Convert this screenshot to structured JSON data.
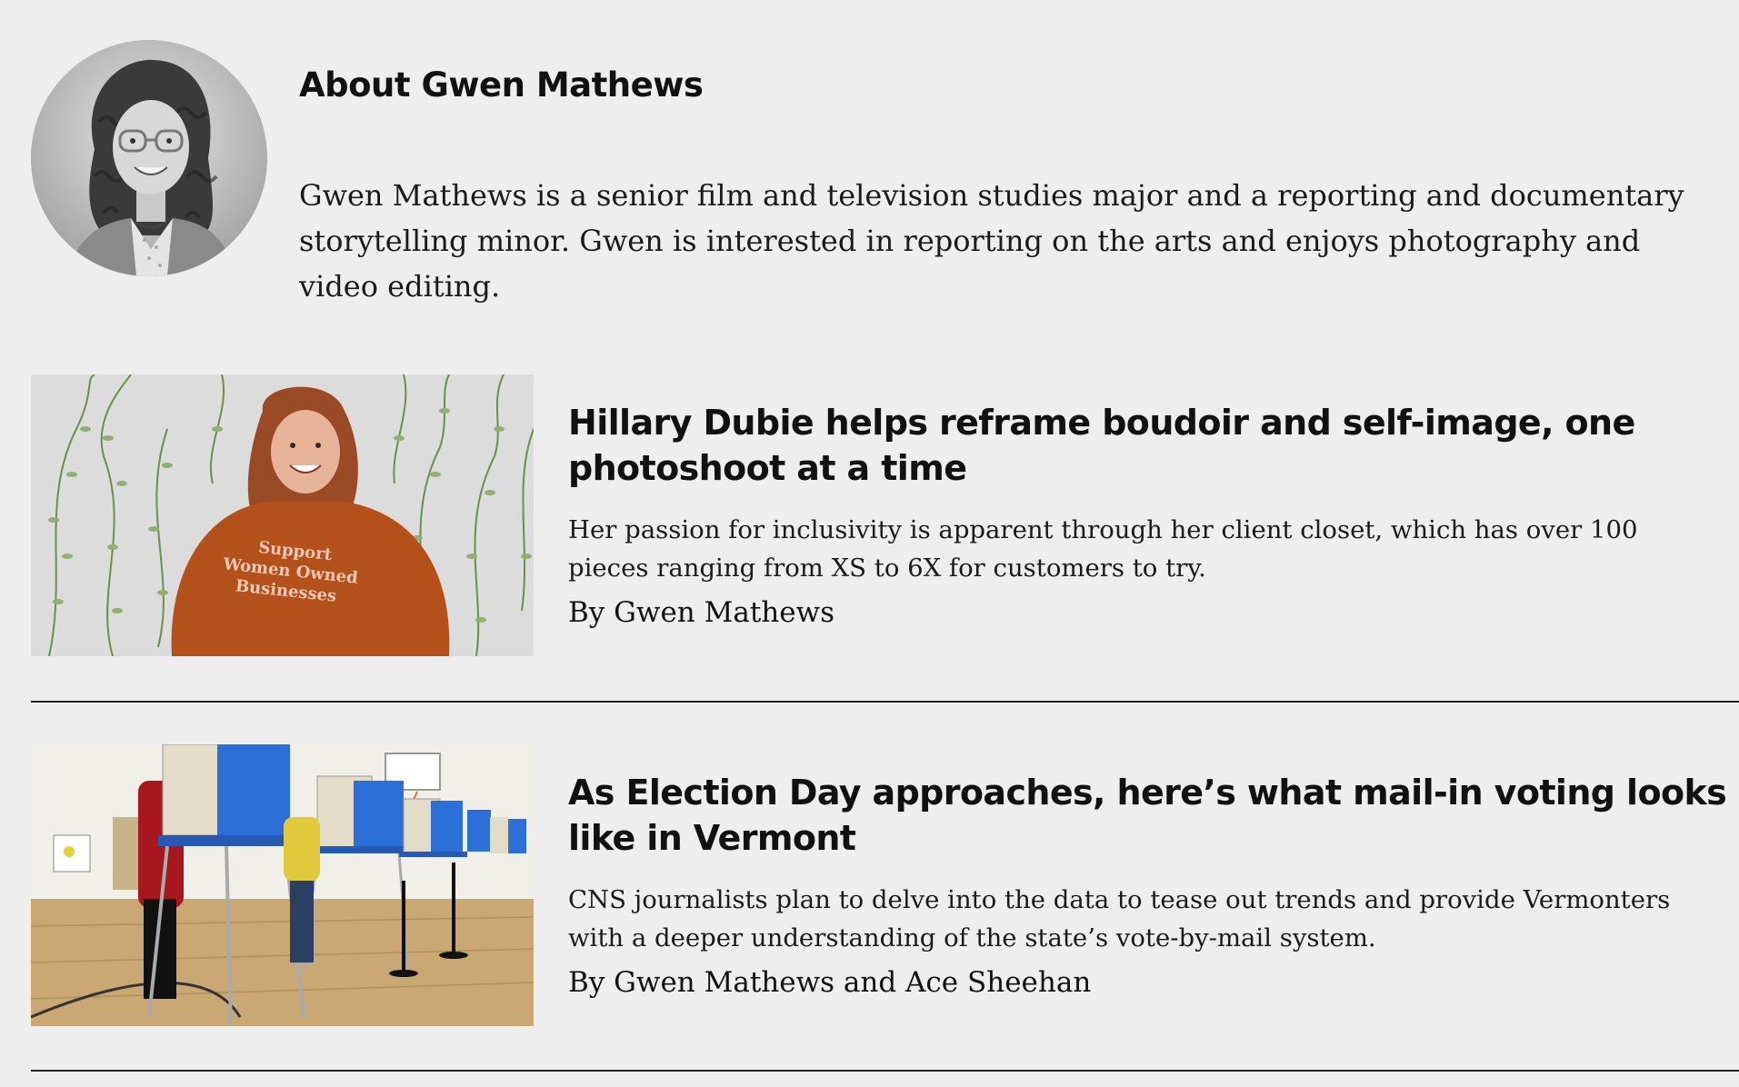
{
  "author": {
    "heading": "About Gwen Mathews",
    "bio": "Gwen Mathews is a senior film and television studies major and a reporting and documentary storytelling minor. Gwen is interested in reporting on the arts and enjoys photography and video editing.",
    "photo_icon": "portrait-photo"
  },
  "articles": [
    {
      "title": "Hillary Dubie helps reframe boudoir and self-image, one photoshoot at a time",
      "dek": "Her passion for inclusivity is apparent through her client closet, which has over 100 pieces ranging from XS to 6X for customers to try.",
      "byline": "By Gwen Mathews",
      "image_icon": "photo-woman-support-shirt",
      "image_shirt_text": [
        "Support",
        "Women Owned",
        "Businesses"
      ]
    },
    {
      "title": "As Election Day approaches, here’s what mail-in voting looks like in Vermont",
      "dek": "CNS journalists plan to delve into the data to tease out trends and provide Vermonters with a deeper understanding of the state’s vote-by-mail system.",
      "byline": "By Gwen Mathews and Ace Sheehan",
      "image_icon": "photo-voting-booths"
    }
  ],
  "colors": {
    "background": "#eeeeef",
    "text": "#111111",
    "divider": "#222222",
    "shirt": "#b4501a",
    "booth_blue": "#2c6fd6"
  }
}
